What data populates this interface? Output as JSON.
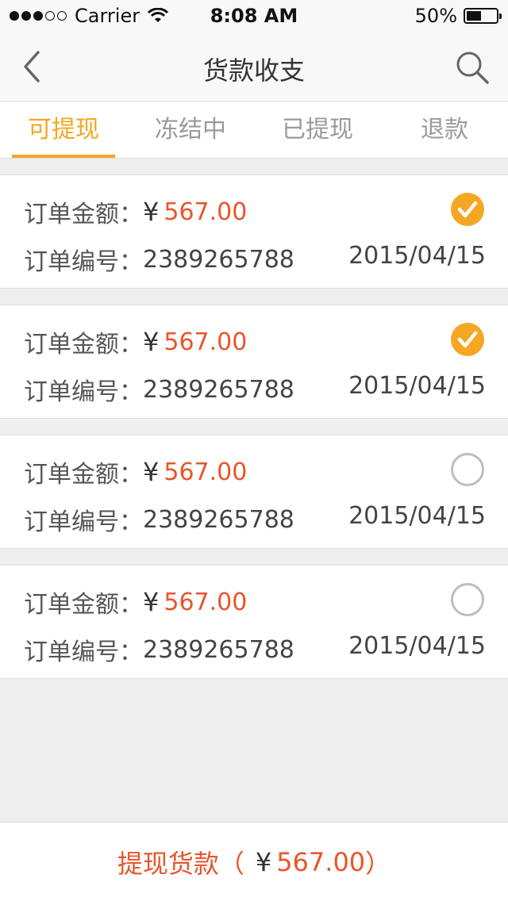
{
  "status_bar": {
    "carrier": "Carrier",
    "time": "8:08 AM",
    "battery": "50%",
    "battery_level": 0.5
  },
  "nav": {
    "title": "货款收支",
    "back_icon": "chevron-left-icon",
    "search_icon": "search-icon"
  },
  "tabs": [
    {
      "label": "可提现",
      "active": true
    },
    {
      "label": "冻结中",
      "active": false
    },
    {
      "label": "已提现",
      "active": false
    },
    {
      "label": "退款",
      "active": false
    }
  ],
  "orders": [
    {
      "amount_label": "订单金额：",
      "currency": "¥",
      "amount": "567.00",
      "number_label": "订单编号：",
      "number": "2389265788",
      "date": "2015/04/15",
      "checked": true
    },
    {
      "amount_label": "订单金额：",
      "currency": "¥",
      "amount": "567.00",
      "number_label": "订单编号：",
      "number": "2389265788",
      "date": "2015/04/15",
      "checked": true
    },
    {
      "amount_label": "订单金额：",
      "currency": "¥",
      "amount": "567.00",
      "number_label": "订单编号：",
      "number": "2389265788",
      "date": "2015/04/15",
      "checked": false
    },
    {
      "amount_label": "订单金额：",
      "currency": "¥",
      "amount": "567.00",
      "number_label": "订单编号：",
      "number": "2389265788",
      "date": "2015/04/15",
      "checked": false
    }
  ],
  "footer": {
    "label": "提现货款（",
    "currency": "¥",
    "amount": "567.00",
    "close": "）"
  },
  "colors": {
    "accent": "#f5a623",
    "amount": "#e8552b"
  }
}
